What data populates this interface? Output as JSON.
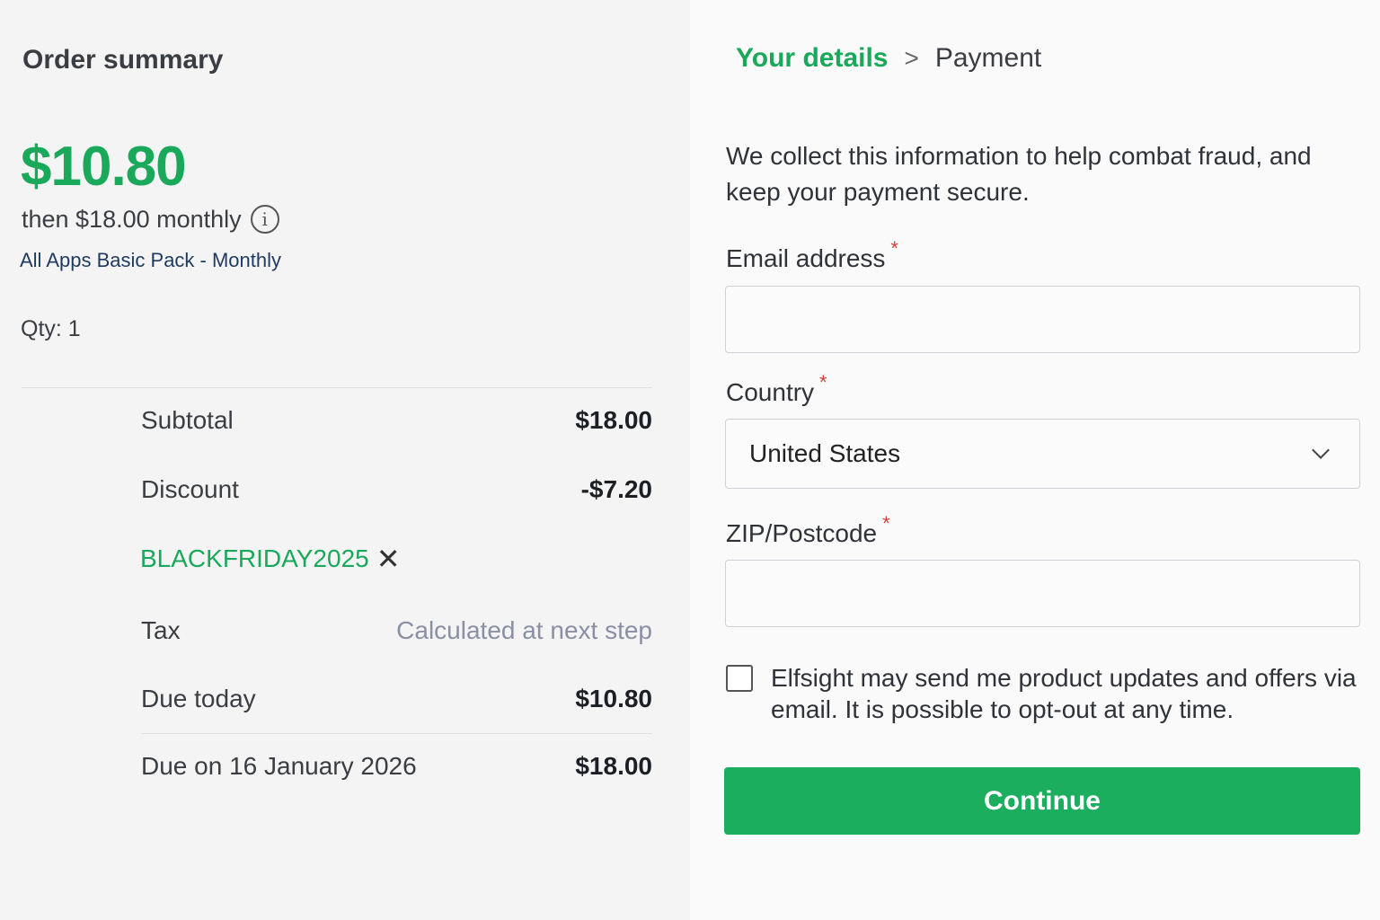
{
  "summary": {
    "title": "Order summary",
    "price": "$10.80",
    "then_text": "then $18.00 monthly",
    "info_icon": "info-circle-icon",
    "plan_name": "All Apps Basic Pack - Monthly",
    "qty": "Qty: 1",
    "subtotal_label": "Subtotal",
    "subtotal_value": "$18.00",
    "discount_label": "Discount",
    "discount_value": "-$7.20",
    "coupon_code": "BLACKFRIDAY2025",
    "coupon_remove_glyph": "✕",
    "tax_label": "Tax",
    "tax_value": "Calculated at next step",
    "due_today_label": "Due today",
    "due_today_value": "$10.80",
    "due_later_label": "Due on 16 January 2026",
    "due_later_value": "$18.00"
  },
  "checkout": {
    "breadcrumb": {
      "active": "Your details",
      "separator": ">",
      "next": "Payment"
    },
    "intro": "We collect this information to help combat fraud, and keep your payment secure.",
    "email_label": "Email address",
    "email_value": "",
    "country_label": "Country",
    "country_value": "United States",
    "zip_label": "ZIP/Postcode",
    "zip_value": "",
    "required_marker": "*",
    "consent_text": "Elfsight may send me product updates and offers via email. It is possible to opt-out at any time.",
    "consent_checked": false,
    "continue_label": "Continue"
  },
  "colors": {
    "accent": "#1aa85a",
    "button": "#1aae5e",
    "required": "#d93a3a",
    "muted": "#8a8fa3"
  }
}
